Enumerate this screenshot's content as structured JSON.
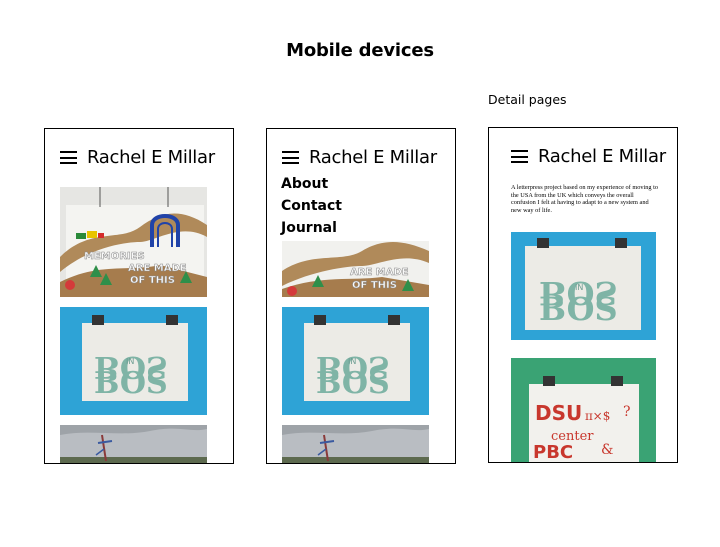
{
  "page": {
    "title": "Mobile devices",
    "detail_label": "Detail pages"
  },
  "site": {
    "brand": "Rachel E Millar"
  },
  "menu": {
    "items": [
      {
        "label": "About"
      },
      {
        "label": "Contact"
      },
      {
        "label": "Journal"
      }
    ]
  },
  "detail": {
    "description": "A letterpress project based on my experience of moving to the USA from the UK which conveys the overall confusion I felt at having to adapt to a new system and new way of life."
  },
  "images": {
    "memories_text": [
      "MEMORIES",
      "ARE MADE",
      "OF THIS"
    ],
    "bos_text": [
      "BOS",
      "IN",
      "BOS"
    ],
    "usa_text": [
      "DSU",
      "center",
      "PBC"
    ]
  },
  "colors": {
    "blue_background": "#2ea3d6",
    "green_background": "#3aa374",
    "letter_green": "#7fb4a6",
    "ink_red": "#c8372d"
  }
}
